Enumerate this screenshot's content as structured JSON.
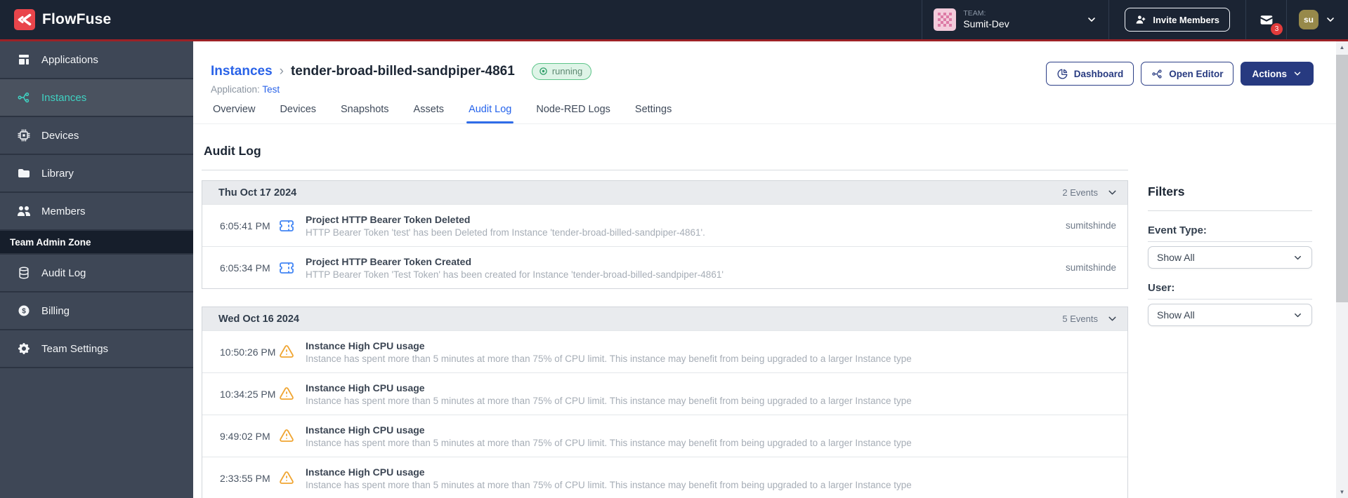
{
  "header": {
    "brand": "FlowFuse",
    "team_label": "TEAM:",
    "team_name": "Sumit-Dev",
    "invite_button": "Invite Members",
    "notification_count": "3",
    "user_initials": "su"
  },
  "sidebar": {
    "items": [
      {
        "label": "Applications",
        "icon": "applications-icon",
        "active": false
      },
      {
        "label": "Instances",
        "icon": "instances-icon",
        "active": true
      },
      {
        "label": "Devices",
        "icon": "devices-icon",
        "active": false
      },
      {
        "label": "Library",
        "icon": "library-icon",
        "active": false
      },
      {
        "label": "Members",
        "icon": "members-icon",
        "active": false
      }
    ],
    "admin_zone_label": "Team Admin Zone",
    "admin_items": [
      {
        "label": "Audit Log",
        "icon": "audit-log-icon",
        "active": false
      },
      {
        "label": "Billing",
        "icon": "billing-icon",
        "active": false
      },
      {
        "label": "Team Settings",
        "icon": "team-settings-icon",
        "active": false
      }
    ]
  },
  "page": {
    "breadcrumb_root": "Instances",
    "instance_name": "tender-broad-billed-sandpiper-4861",
    "status": "running",
    "application_label": "Application:",
    "application_name": "Test",
    "buttons": {
      "dashboard": "Dashboard",
      "open_editor": "Open Editor",
      "actions": "Actions"
    },
    "tabs": [
      {
        "label": "Overview",
        "active": false
      },
      {
        "label": "Devices",
        "active": false
      },
      {
        "label": "Snapshots",
        "active": false
      },
      {
        "label": "Assets",
        "active": false
      },
      {
        "label": "Audit Log",
        "active": true
      },
      {
        "label": "Node-RED Logs",
        "active": false
      },
      {
        "label": "Settings",
        "active": false
      }
    ],
    "section_title": "Audit Log"
  },
  "audit": {
    "groups": [
      {
        "date": "Thu Oct 17 2024",
        "events_count": "2 Events",
        "events": [
          {
            "time": "6:05:41 PM",
            "icon": "token-icon",
            "title": "Project HTTP Bearer Token Deleted",
            "description": "HTTP Bearer Token 'test' has been Deleted from Instance 'tender-broad-billed-sandpiper-4861'.",
            "user": "sumitshinde"
          },
          {
            "time": "6:05:34 PM",
            "icon": "token-icon",
            "title": "Project HTTP Bearer Token Created",
            "description": "HTTP Bearer Token 'Test Token' has been created for Instance 'tender-broad-billed-sandpiper-4861'",
            "user": "sumitshinde"
          }
        ]
      },
      {
        "date": "Wed Oct 16 2024",
        "events_count": "5 Events",
        "events": [
          {
            "time": "10:50:26 PM",
            "icon": "warning-icon",
            "title": "Instance High CPU usage",
            "description": "Instance has spent more than 5 minutes at more than 75% of CPU limit. This instance may benefit from being upgraded to a larger Instance type",
            "user": ""
          },
          {
            "time": "10:34:25 PM",
            "icon": "warning-icon",
            "title": "Instance High CPU usage",
            "description": "Instance has spent more than 5 minutes at more than 75% of CPU limit. This instance may benefit from being upgraded to a larger Instance type",
            "user": ""
          },
          {
            "time": "9:49:02 PM",
            "icon": "warning-icon",
            "title": "Instance High CPU usage",
            "description": "Instance has spent more than 5 minutes at more than 75% of CPU limit. This instance may benefit from being upgraded to a larger Instance type",
            "user": ""
          },
          {
            "time": "2:33:55 PM",
            "icon": "warning-icon",
            "title": "Instance High CPU usage",
            "description": "Instance has spent more than 5 minutes at more than 75% of CPU limit. This instance may benefit from being upgraded to a larger Instance type",
            "user": ""
          }
        ]
      }
    ]
  },
  "filters": {
    "title": "Filters",
    "event_type_label": "Event Type:",
    "event_type_value": "Show All",
    "user_label": "User:",
    "user_value": "Show All"
  },
  "colors": {
    "accent_red_line": "#9c2126",
    "brand_red": "#e9454b",
    "navbar_bg": "#1b2433",
    "sidebar_bg": "#3e4756",
    "sidebar_active_teal": "#3fd2c2",
    "link_blue": "#2a63e8",
    "tab_active_blue": "#2563eb",
    "primary_navy": "#273a80",
    "status_green": "#2f9e68",
    "status_badge_bg": "#def4e7",
    "token_icon_blue": "#4285f4",
    "warning_icon_orange": "#f0a532",
    "notification_red": "#e23b3b"
  }
}
